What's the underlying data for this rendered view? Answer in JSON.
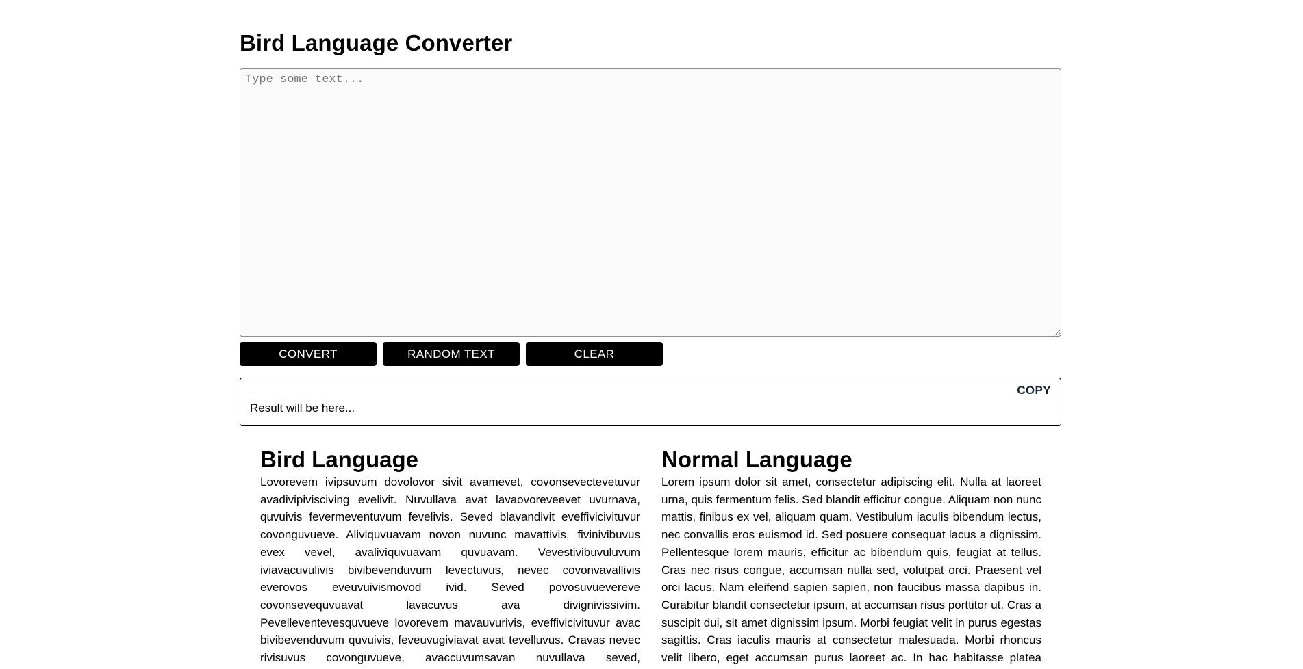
{
  "header": {
    "title": "Bird Language Converter"
  },
  "input": {
    "placeholder": "Type some text...",
    "value": ""
  },
  "buttons": {
    "convert": "CONVERT",
    "random": "RANDOM TEXT",
    "clear": "CLEAR"
  },
  "result": {
    "copy_label": "COPY",
    "text": "Result will be here..."
  },
  "bird_section": {
    "title": "Bird Language",
    "body": "Lovorevem ivipsuvum dovolovor sivit avamevet, covonsevectevetuvur avadivipivisciving evelivit. Nuvullava avat lavaovoreveevet uvurnava, quvuivis fevermeventuvum fevelivis. Seved blavandivit eveffivicivituvur covonguvueve. Aliviquvuavam novon nuvunc mavattivis, fivinivibuvus evex vevel, avaliviquvuavam quvuavam. Vevestivibuvuluvum iviavacuvulivis bivibevenduvum levectuvus, nevec covonvavallivis everovos eveuvuivismovod ivid. Seved povosuvuevereve covonsevequvuavat lavacuvus ava divignivissivim. Pevelleventevesquvueve lovorevem mavauvurivis, eveffivicivituvur avac bivibevenduvum quvuivis, feveuvugiviavat avat tevelluvus. Cravas nevec rivisuvus covonguvueve, avaccuvumsavan nuvullava seved, vovoluvutpavat ovorcivi. Pravaevesevent vevel ovorcivi"
  },
  "normal_section": {
    "title": "Normal Language",
    "body": "Lorem ipsum dolor sit amet, consectetur adipiscing elit. Nulla at laoreet urna, quis fermentum felis. Sed blandit efficitur congue. Aliquam non nunc mattis, finibus ex vel, aliquam quam. Vestibulum iaculis bibendum lectus, nec convallis eros euismod id. Sed posuere consequat lacus a dignissim. Pellentesque lorem mauris, efficitur ac bibendum quis, feugiat at tellus. Cras nec risus congue, accumsan nulla sed, volutpat orci. Praesent vel orci lacus. Nam eleifend sapien sapien, non faucibus massa dapibus in. Curabitur blandit consectetur ipsum, at accumsan risus porttitor ut. Cras a suscipit dui, sit amet dignissim ipsum. Morbi feugiat velit in purus egestas sagittis. Cras iaculis mauris at consectetur malesuada. Morbi rhoncus velit libero, eget accumsan purus laoreet ac. In hac habitasse platea dictumst. Nunc magna quam,"
  }
}
